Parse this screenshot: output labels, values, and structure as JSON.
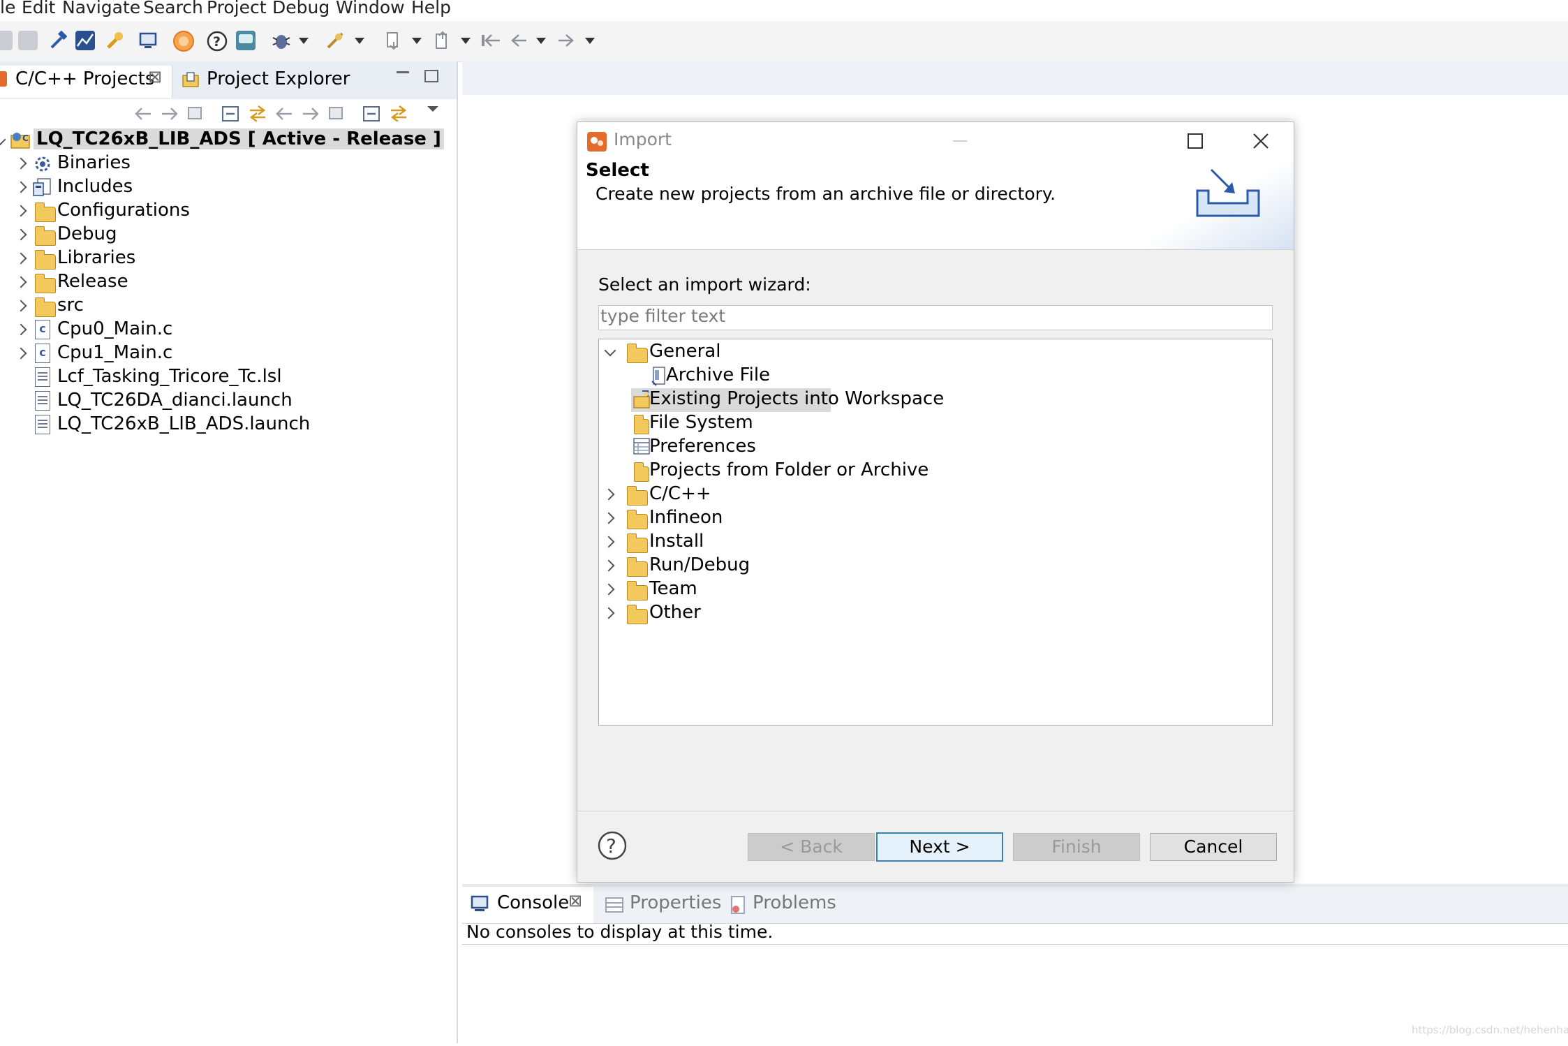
{
  "menubar": {
    "items": [
      "le",
      "Edit",
      "Navigate",
      "Search",
      "Project",
      "Debug",
      "Window",
      "Help"
    ]
  },
  "left_panel": {
    "tab_projects": "C/C++ Projects",
    "tab_explorer": "Project Explorer",
    "tree": {
      "root": "LQ_TC26xB_LIB_ADS [ Active - Release ]",
      "items": [
        "Binaries",
        "Includes",
        "Configurations",
        "Debug",
        "Libraries",
        "Release",
        "src",
        "Cpu0_Main.c",
        "Cpu1_Main.c",
        "Lcf_Tasking_Tricore_Tc.lsl",
        "LQ_TC26DA_dianci.launch",
        "LQ_TC26xB_LIB_ADS.launch"
      ]
    }
  },
  "dialog": {
    "title": "Import",
    "header_title": "Select",
    "header_description": "Create new projects from an archive file or directory.",
    "wizard_label": "Select an import wizard:",
    "filter_placeholder": "type filter text",
    "tree": {
      "general": "General",
      "general_children": [
        "Archive File",
        "Existing Projects into Workspace",
        "File System",
        "Preferences",
        "Projects from Folder or Archive"
      ],
      "categories": [
        "C/C++",
        "Infineon",
        "Install",
        "Run/Debug",
        "Team",
        "Other"
      ],
      "selected": "Existing Projects into Workspace"
    },
    "buttons": {
      "back": "< Back",
      "next": "Next >",
      "finish": "Finish",
      "cancel": "Cancel"
    }
  },
  "console": {
    "tab_console": "Console",
    "tab_properties": "Properties",
    "tab_problems": "Problems",
    "message": "No consoles to display at this time."
  },
  "watermark": "https://blog.csdn.net/hehenha",
  "colors": {
    "selection": "#dadada",
    "accent": "#3c7fb1",
    "folder": "#f3c85c",
    "panel_tab_bg": "#e9eef5"
  }
}
